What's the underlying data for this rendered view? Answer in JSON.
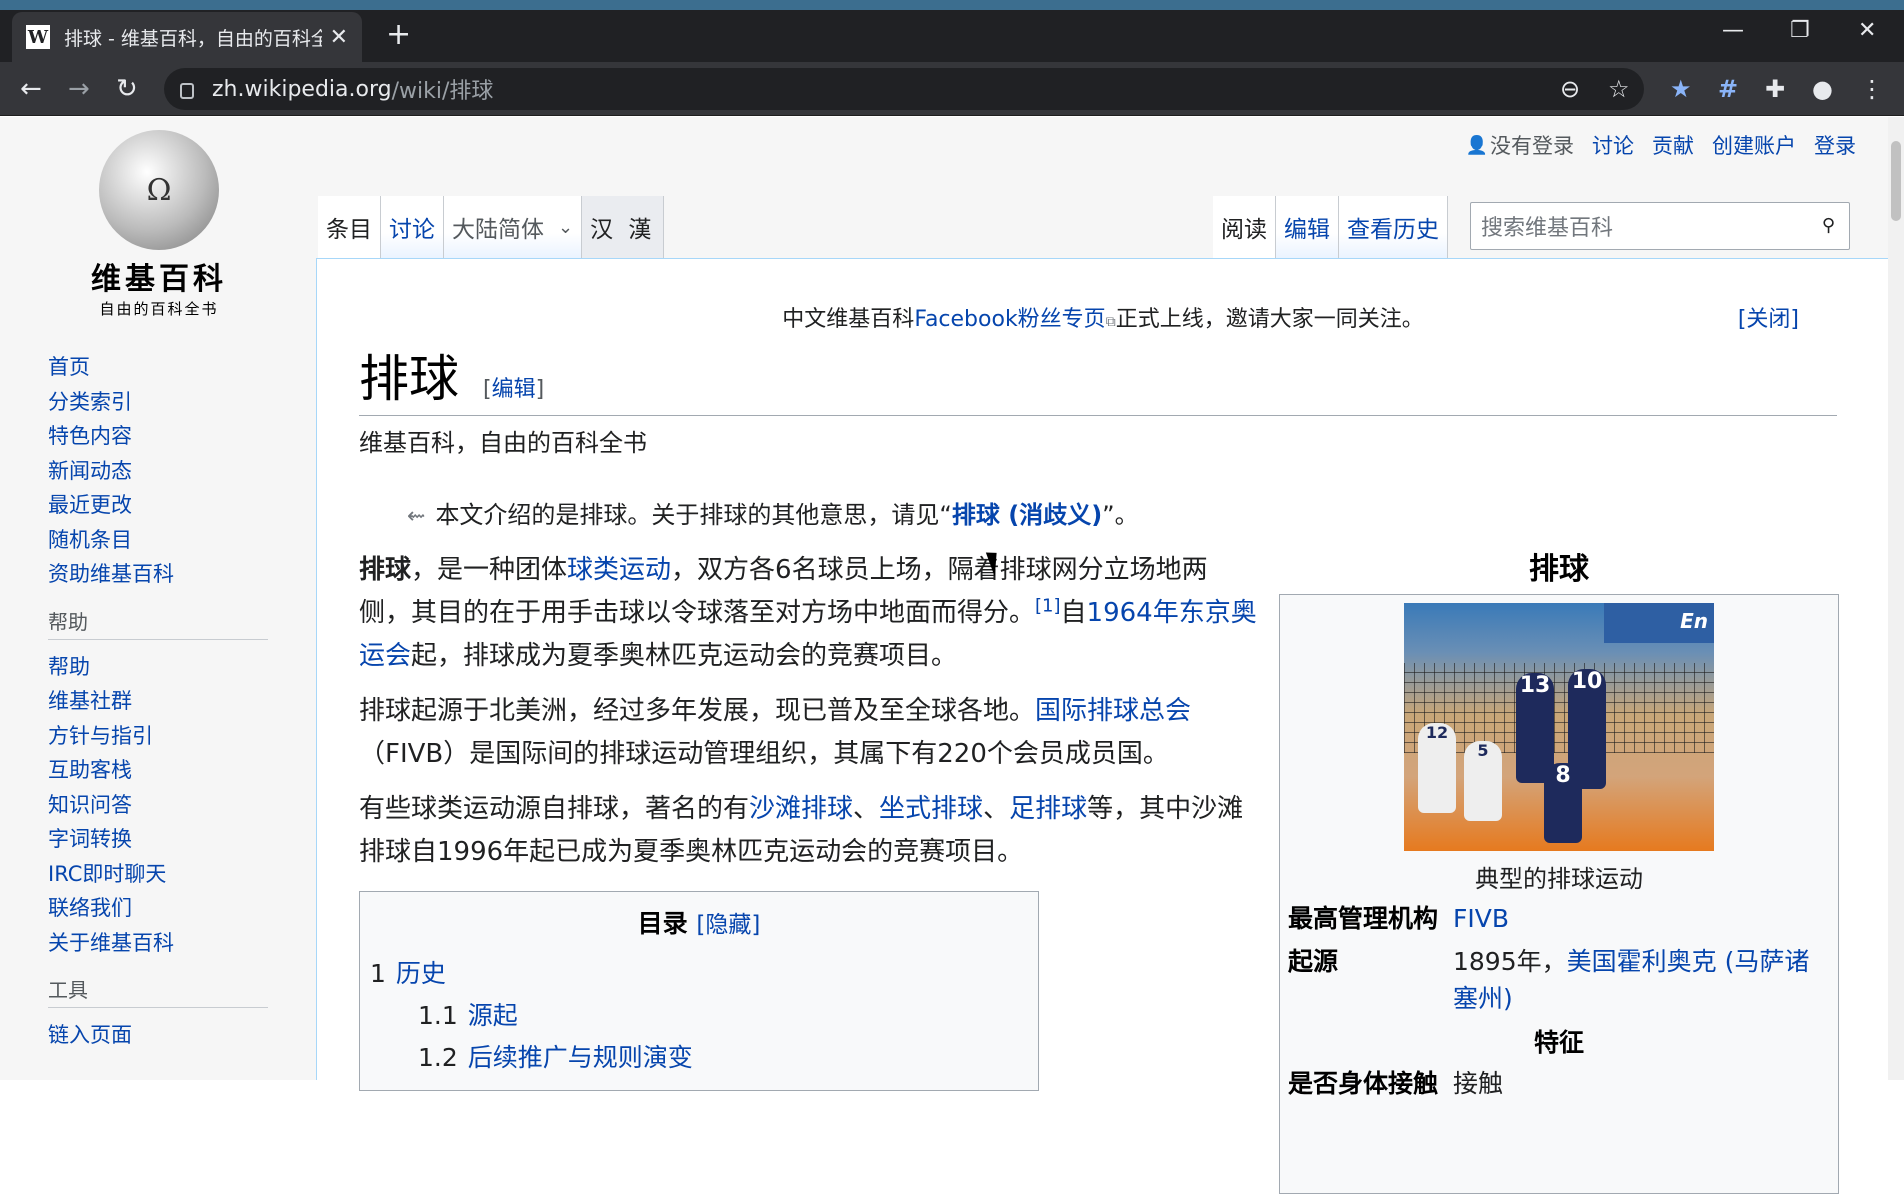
{
  "browser": {
    "tab_title": "排球 - 维基百科，自由的百科全书",
    "favicon": "W",
    "new_tab": "+",
    "url_host": "zh.wikipedia.org",
    "url_path": "/wiki/排球",
    "min": "—",
    "restore": "❐",
    "close": "✕",
    "back": "←",
    "forward": "→",
    "reload": "↻",
    "zoom_icon": "⊖",
    "star_icon": "☆",
    "ext1_icon": "★",
    "ext2_icon": "#",
    "puzzle_icon": "✚",
    "profile_icon": "●",
    "menu_icon": "⋮"
  },
  "wiki": {
    "wordmark": "维基百科",
    "tagline": "自由的百科全书",
    "globe_glyph": "Ω",
    "personal": {
      "not_logged_in": "没有登录",
      "talk": "讨论",
      "contrib": "贡献",
      "create": "创建账户",
      "login": "登录"
    },
    "tabs": {
      "article": "条目",
      "talk": "讨论",
      "variant": "大陆简体",
      "variant_arrow": "⌄",
      "hanzi": "汉 漢",
      "read": "阅读",
      "edit": "编辑",
      "history": "查看历史"
    },
    "search_placeholder": "搜索维基百科",
    "search_icon": "🔍",
    "nav": [
      "首页",
      "分类索引",
      "特色内容",
      "新闻动态",
      "最近更改",
      "随机条目",
      "资助维基百科"
    ],
    "help_header": "帮助",
    "help": [
      "帮助",
      "维基社群",
      "方针与指引",
      "互助客栈",
      "知识问答",
      "字词转换",
      "IRC即时聊天",
      "联络我们",
      "关于维基百科"
    ],
    "tools_header": "工具",
    "tools": [
      "链入页面"
    ]
  },
  "notice": {
    "pre": "中文维基百科",
    "link": "Facebook粉丝专页",
    "post": "正式上线，邀请大家一同关注。",
    "close": "[关闭]"
  },
  "article": {
    "title": "排球",
    "edit_open": "[",
    "edit": "编辑",
    "edit_close": "]",
    "sitesub": "维基百科，自由的百科全书",
    "hatnote_pre": "本文介绍的是排球。关于排球的其他意思，请见“",
    "hatnote_link": "排球 (消歧义)",
    "hatnote_post": "”。",
    "p1": {
      "bold": "排球",
      "a": "，是一种团体",
      "link1": "球类运动",
      "b": "，双方各6名球员上场，隔着排球网分立场地两侧，其目的在于用手击球以令球落至对方场中地面而得分。",
      "ref": "[1]",
      "c": "自",
      "link2": "1964年东京奥运会",
      "d": "起，排球成为夏季奥林匹克运动会的竞赛项目。"
    },
    "p2": {
      "a": "排球起源于北美洲，经过多年发展，现已普及至全球各地。",
      "link": "国际排球总会",
      "b": "（FIVB）是国际间的排球运动管理组织，其属下有220个会员成员国。"
    },
    "p3": {
      "a": "有些球类运动源自排球，著名的有",
      "link1": "沙滩排球",
      "sep1": "、",
      "link2": "坐式排球",
      "sep2": "、",
      "link3": "足排球",
      "b": "等，其中沙滩排球自1996年起已成为夏季奥林匹克运动会的竞赛项目。"
    },
    "toc": {
      "title": "目录",
      "hide": "[隐藏]",
      "items": [
        {
          "num": "1",
          "label": "历史"
        },
        {
          "num": "1.1",
          "label": "源起"
        },
        {
          "num": "1.2",
          "label": "后续推广与规则演变"
        }
      ]
    }
  },
  "infobox": {
    "caption": "排球",
    "image_sign": "En",
    "player_numbers": [
      "13",
      "10",
      "12",
      "5",
      "8"
    ],
    "image_caption": "典型的排球运动",
    "rows": [
      {
        "key": "最高管理机构",
        "value": "FIVB"
      },
      {
        "key": "起源",
        "value_pre": "1895年，",
        "value_link": "美国霍利奥克 (马萨诸塞州)"
      }
    ],
    "section": "特征",
    "row3_key": "是否身体接触",
    "row3_value": "接触"
  }
}
